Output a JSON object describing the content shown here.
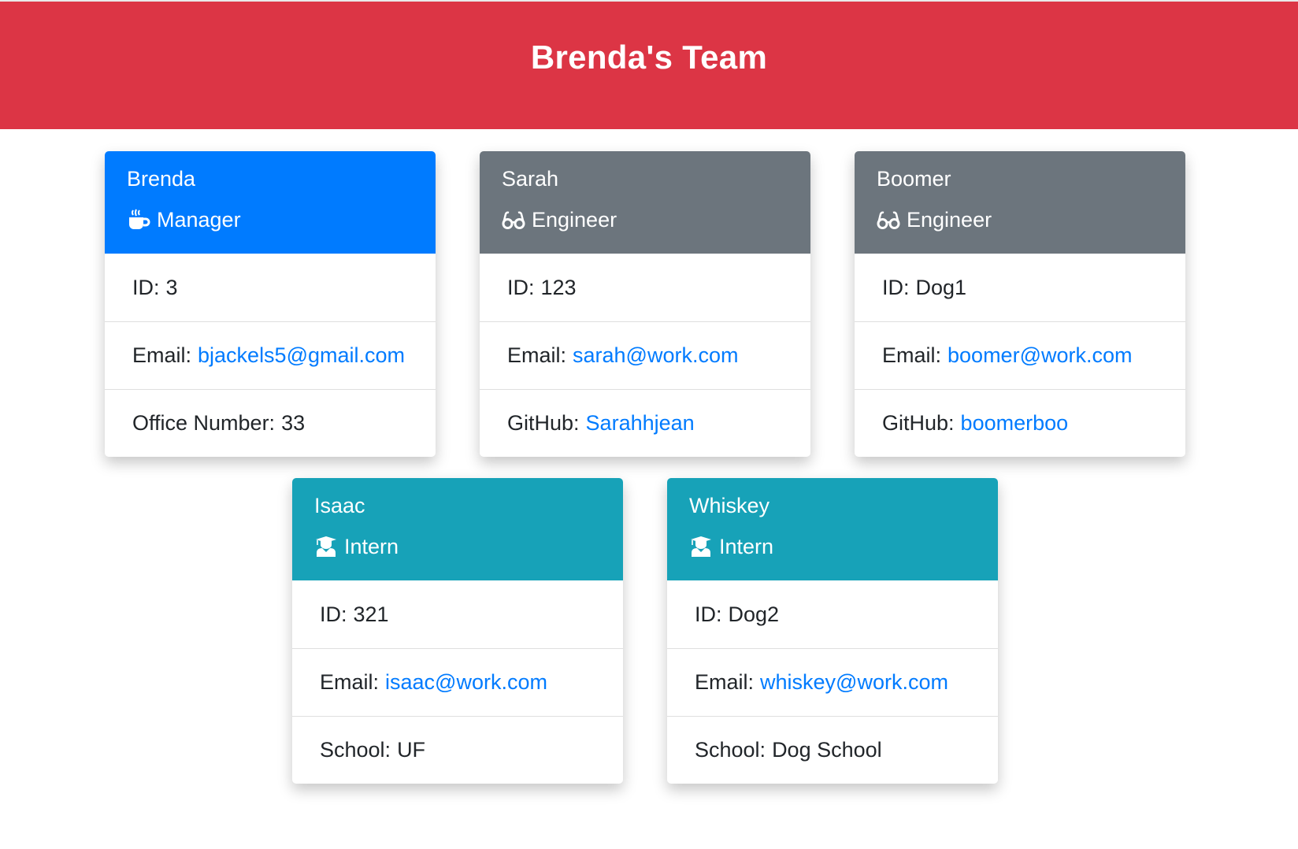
{
  "header": {
    "title": "Brenda's Team"
  },
  "cards": [
    {
      "name": "Brenda",
      "role": "Manager",
      "icon": "mug-icon",
      "id_label": "ID:",
      "id": "3",
      "email_label": "Email:",
      "email": "bjackels5@gmail.com",
      "extra_label": "Office Number:",
      "extra": "33"
    },
    {
      "name": "Sarah",
      "role": "Engineer",
      "icon": "glasses-icon",
      "id_label": "ID:",
      "id": "123",
      "email_label": "Email:",
      "email": "sarah@work.com",
      "extra_label": "GitHub:",
      "extra": "Sarahhjean"
    },
    {
      "name": "Boomer",
      "role": "Engineer",
      "icon": "glasses-icon",
      "id_label": "ID:",
      "id": "Dog1",
      "email_label": "Email:",
      "email": "boomer@work.com",
      "extra_label": "GitHub:",
      "extra": "boomerboo"
    },
    {
      "name": "Isaac",
      "role": "Intern",
      "icon": "graduate-icon",
      "id_label": "ID:",
      "id": "321",
      "email_label": "Email:",
      "email": "isaac@work.com",
      "extra_label": "School:",
      "extra": "UF"
    },
    {
      "name": "Whiskey",
      "role": "Intern",
      "icon": "graduate-icon",
      "id_label": "ID:",
      "id": "Dog2",
      "email_label": "Email:",
      "email": "whiskey@work.com",
      "extra_label": "School:",
      "extra": "Dog School"
    }
  ],
  "colors": {
    "header_bg": "#dc3545",
    "manager": "#007bff",
    "engineer": "#6c757d",
    "intern": "#17a2b8",
    "link": "#007bff"
  }
}
